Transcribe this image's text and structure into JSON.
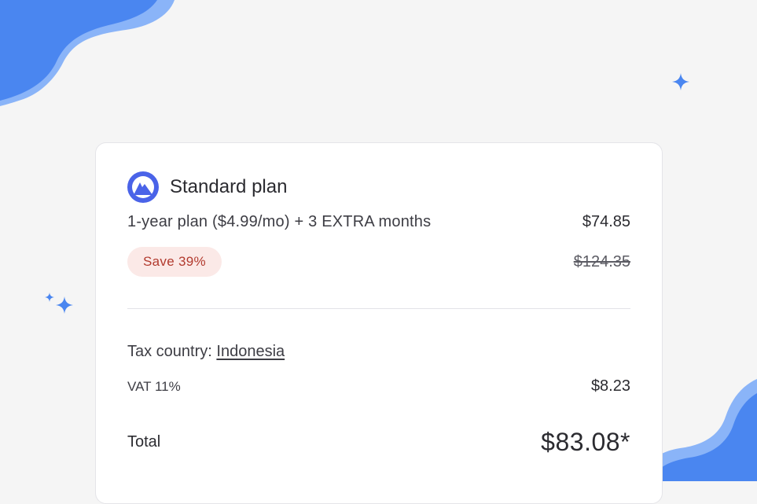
{
  "plan": {
    "title": "Standard plan",
    "description": "1-year plan ($4.99/mo) + 3 EXTRA months",
    "price": "$74.85",
    "save_badge": "Save 39%",
    "original_price": "$124.35"
  },
  "tax": {
    "country_label": "Tax country:",
    "country_value": "Indonesia",
    "vat_label": "VAT 11%",
    "vat_value": "$8.23"
  },
  "total": {
    "label": "Total",
    "value": "$83.08*"
  },
  "colors": {
    "background": "#f5f5f5",
    "card": "#ffffff",
    "accent_blue": "#4285f4",
    "badge_bg": "#fbe9e7",
    "badge_text": "#b23a2e"
  },
  "icons": [
    "nordvpn-logo-icon",
    "sparkle-icon",
    "wave-blob"
  ]
}
